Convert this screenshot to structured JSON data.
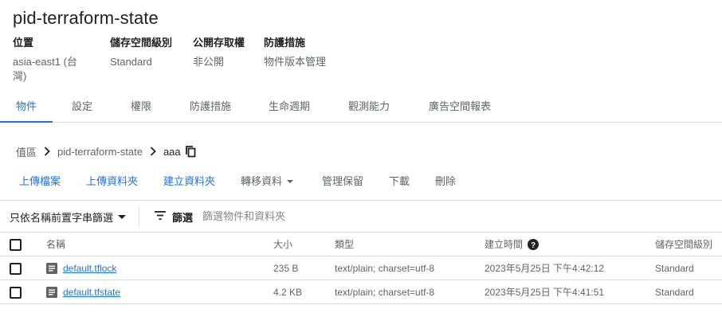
{
  "bucket": {
    "title": "pid-terraform-state",
    "meta": [
      {
        "label": "位置",
        "value": "asia-east1 (台灣)"
      },
      {
        "label": "儲存空間級別",
        "value": "Standard"
      },
      {
        "label": "公開存取權",
        "value": "非公開"
      },
      {
        "label": "防護措施",
        "value": "物件版本管理"
      }
    ]
  },
  "tabs": [
    {
      "label": "物件",
      "active": true
    },
    {
      "label": "設定",
      "active": false
    },
    {
      "label": "權限",
      "active": false
    },
    {
      "label": "防護措施",
      "active": false
    },
    {
      "label": "生命週期",
      "active": false
    },
    {
      "label": "觀測能力",
      "active": false
    },
    {
      "label": "廣告空間報表",
      "active": false
    }
  ],
  "breadcrumb": {
    "items": [
      "值區",
      "pid-terraform-state",
      "aaa"
    ],
    "copy_icon": "copy-icon",
    "separator_icon": "chevron-right-icon"
  },
  "actions": {
    "upload_files": "上傳檔案",
    "upload_folder": "上傳資料夾",
    "create_folder": "建立資料夾",
    "transfer_data": "轉移資料",
    "manage_holds": "管理保留",
    "download": "下載",
    "delete": "刪除"
  },
  "filter": {
    "prefix_select": "只依名稱前置字串篩選",
    "filter_label": "篩選",
    "placeholder": "篩選物件和資料夾",
    "filter_icon": "filter-list-icon"
  },
  "table": {
    "headers": {
      "name": "名稱",
      "size": "大小",
      "type": "類型",
      "created": "建立時間",
      "storage_class": "儲存空間級別"
    },
    "help_icon": "help-icon",
    "rows": [
      {
        "name": "default.tflock",
        "size": "235 B",
        "type": "text/plain; charset=utf-8",
        "created": "2023年5月25日 下午4:42:12",
        "storage_class": "Standard"
      },
      {
        "name": "default.tfstate",
        "size": "4.2 KB",
        "type": "text/plain; charset=utf-8",
        "created": "2023年5月25日 下午4:41:51",
        "storage_class": "Standard"
      }
    ]
  },
  "colors": {
    "accent": "#1a73e8",
    "text": "#202124",
    "secondary_text": "#5f6368",
    "divider": "#dadce0"
  }
}
